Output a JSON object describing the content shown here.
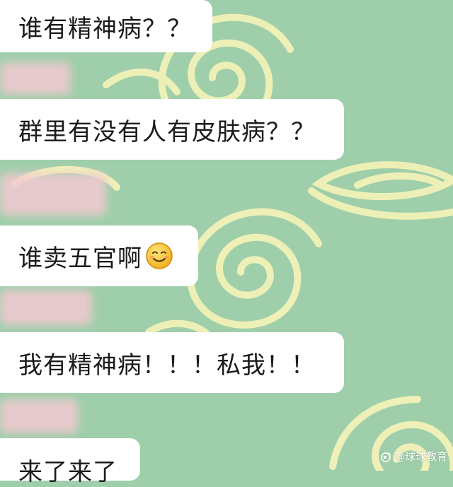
{
  "messages": [
    {
      "text": "谁有精神病？？"
    },
    {
      "text": "群里有没有人有皮肤病？？"
    },
    {
      "text": "谁卖五官啊",
      "emoji": "smile-icon"
    },
    {
      "text": "我有精神病！！！私我！！"
    },
    {
      "text": "来了来了"
    }
  ],
  "watermark": {
    "text": "@球球教育",
    "icon": "weibo-icon"
  },
  "colors": {
    "background": "#9fceaa",
    "swirl": "#f6f4b8",
    "bubble": "#ffffff",
    "text": "#1b1b1b",
    "avatar_blur": "#f3c9d2"
  }
}
